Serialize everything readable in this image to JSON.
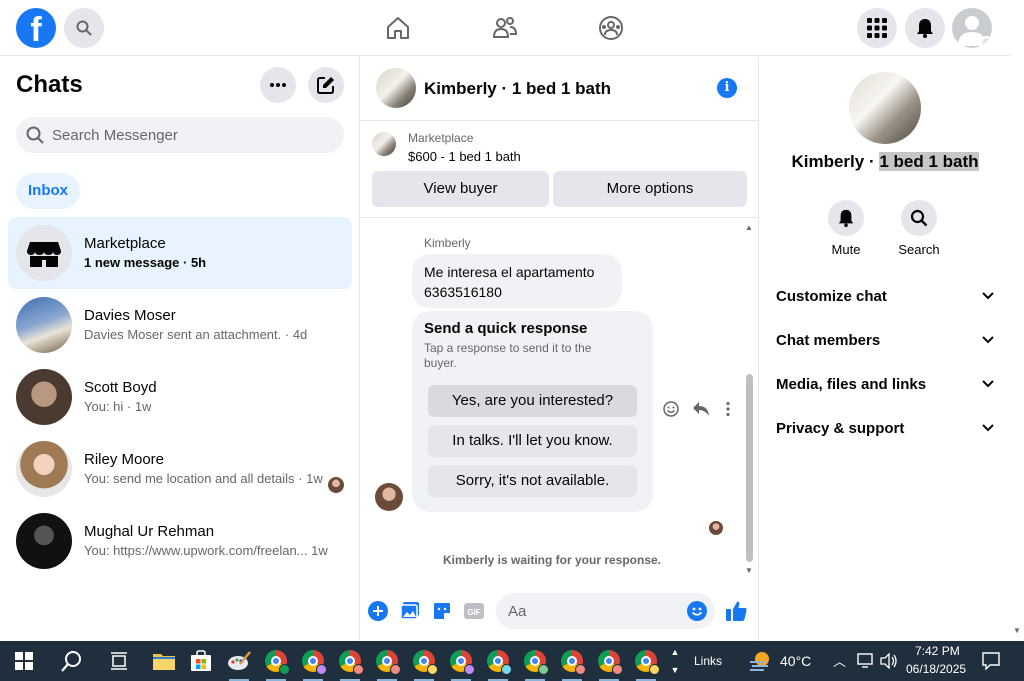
{
  "topnav": {
    "logo": "f",
    "icons": [
      "search-icon",
      "home-icon",
      "friends-icon",
      "groups-icon",
      "menu-grid-icon",
      "notifications-bell-icon"
    ]
  },
  "left": {
    "title": "Chats",
    "search_placeholder": "Search Messenger",
    "inbox_label": "Inbox",
    "chats": [
      {
        "name": "Marketplace",
        "subtitle": "1 new message · 5h",
        "unread": true,
        "active": true
      },
      {
        "name": "Davies Moser",
        "subtitle": "Davies Moser sent an attachment. · 4d",
        "unread": false
      },
      {
        "name": "Scott Boyd",
        "subtitle": "You: hi · 1w",
        "unread": false
      },
      {
        "name": "Riley Moore",
        "subtitle": "You: send me location and all details · 1w",
        "unread": false
      },
      {
        "name": "Mughal Ur Rehman",
        "subtitle": "You: https://www.upwork.com/freelan... 1w",
        "unread": false
      }
    ]
  },
  "conversation": {
    "title": "Kimberly · 1 bed 1 bath",
    "listing": {
      "source": "Marketplace",
      "price_title": "$600 - 1 bed 1 bath",
      "view_buyer": "View buyer",
      "more_options": "More options"
    },
    "sender_name": "Kimberly",
    "message_line1": "Me interesa el apartamento",
    "message_line2": "6363516180",
    "quick_response": {
      "title": "Send a quick response",
      "description": "Tap a response to send it to the buyer.",
      "options": [
        "Yes, are you interested?",
        "In talks. I'll let you know.",
        "Sorry, it's not available."
      ]
    },
    "waiting_text": "Kimberly is waiting for your response.",
    "composer_placeholder": "Aa"
  },
  "right": {
    "name_prefix": "Kimberly · ",
    "name_selected": "1 bed 1 bath",
    "actions": [
      "Mute",
      "Search"
    ],
    "sections": [
      "Customize chat",
      "Chat members",
      "Media, files and links",
      "Privacy & support"
    ]
  },
  "taskbar": {
    "links": "Links",
    "temperature": "40°C",
    "time": "7:42 PM",
    "date": "06/18/2025"
  },
  "colors": {
    "accent": "#1877f2",
    "active_bg": "#e7f3ff",
    "taskbar": "#1f2f3d"
  }
}
